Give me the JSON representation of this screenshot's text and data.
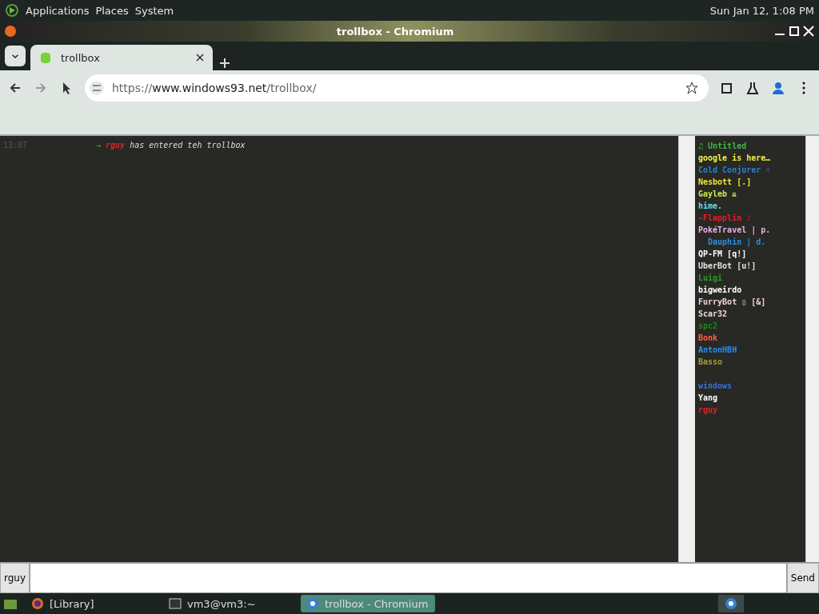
{
  "top_panel": {
    "menus": [
      "Applications",
      "Places",
      "System"
    ],
    "clock": "Sun Jan 12, 1:08 PM"
  },
  "window": {
    "title": "trollbox - Chromium"
  },
  "tabs": [
    {
      "label": "trollbox",
      "selected": true
    }
  ],
  "address_bar": {
    "url_prefix": "https://",
    "url_host": "www.windows93.net",
    "url_path": "/trollbox/"
  },
  "messages": [
    {
      "time": "13:07",
      "arrow": "→",
      "nick": "rguy",
      "color": "#e0202a",
      "text": "has entered teh trollbox"
    }
  ],
  "users": [
    {
      "name": "♫ Untitled",
      "color": "#3fb54a"
    },
    {
      "name": "google is here…",
      "color": "#f2f23c"
    },
    {
      "name": "Cold Conjurer ☼",
      "color": "#2a7fd4"
    },
    {
      "name": "Nesbott [.]",
      "color": "#f2e23a"
    },
    {
      "name": "Gayleb ⇊",
      "color": "#c7e84a"
    },
    {
      "name": "hime.",
      "color": "#5fe0f0"
    },
    {
      "name": "-Flapplin ♪",
      "color": "#e0202a"
    },
    {
      "name": "PokéTravel | p.",
      "color": "#e6b3e6"
    },
    {
      "name": "  Dauphin | d.",
      "color": "#2a8fe0"
    },
    {
      "name": "QP-FM [q!]",
      "color": "#ffffff"
    },
    {
      "name": "UberBot [u!]",
      "color": "#e0e0e0"
    },
    {
      "name": "Luigi",
      "color": "#2a9a2a"
    },
    {
      "name": "bigweirdo",
      "color": "#ffffff"
    },
    {
      "name": "FurryBot ▯ [&]",
      "color": "#f0d0e0"
    },
    {
      "name": "Scar32",
      "color": "#f0d8d8"
    },
    {
      "name": "spc2",
      "color": "#1a8a1a"
    },
    {
      "name": "Bonk",
      "color": "#ff6040"
    },
    {
      "name": "AntonHBH",
      "color": "#2a8ff0"
    },
    {
      "name": "Basso",
      "color": "#a0a040"
    },
    {
      "name": "windows",
      "color": "#3a70d0",
      "gap_before": true
    },
    {
      "name": "Yang",
      "color": "#ffffff"
    },
    {
      "name": "rguy",
      "color": "#e0202a"
    }
  ],
  "input": {
    "nick": "rguy",
    "send": "Send"
  },
  "taskbar": {
    "items": [
      {
        "label": "[Library]",
        "kind": "firefox",
        "selected": false
      },
      {
        "label": "vm3@vm3:~",
        "kind": "terminal",
        "selected": false
      },
      {
        "label": "trollbox - Chromium",
        "kind": "chrome",
        "selected": true
      }
    ]
  }
}
